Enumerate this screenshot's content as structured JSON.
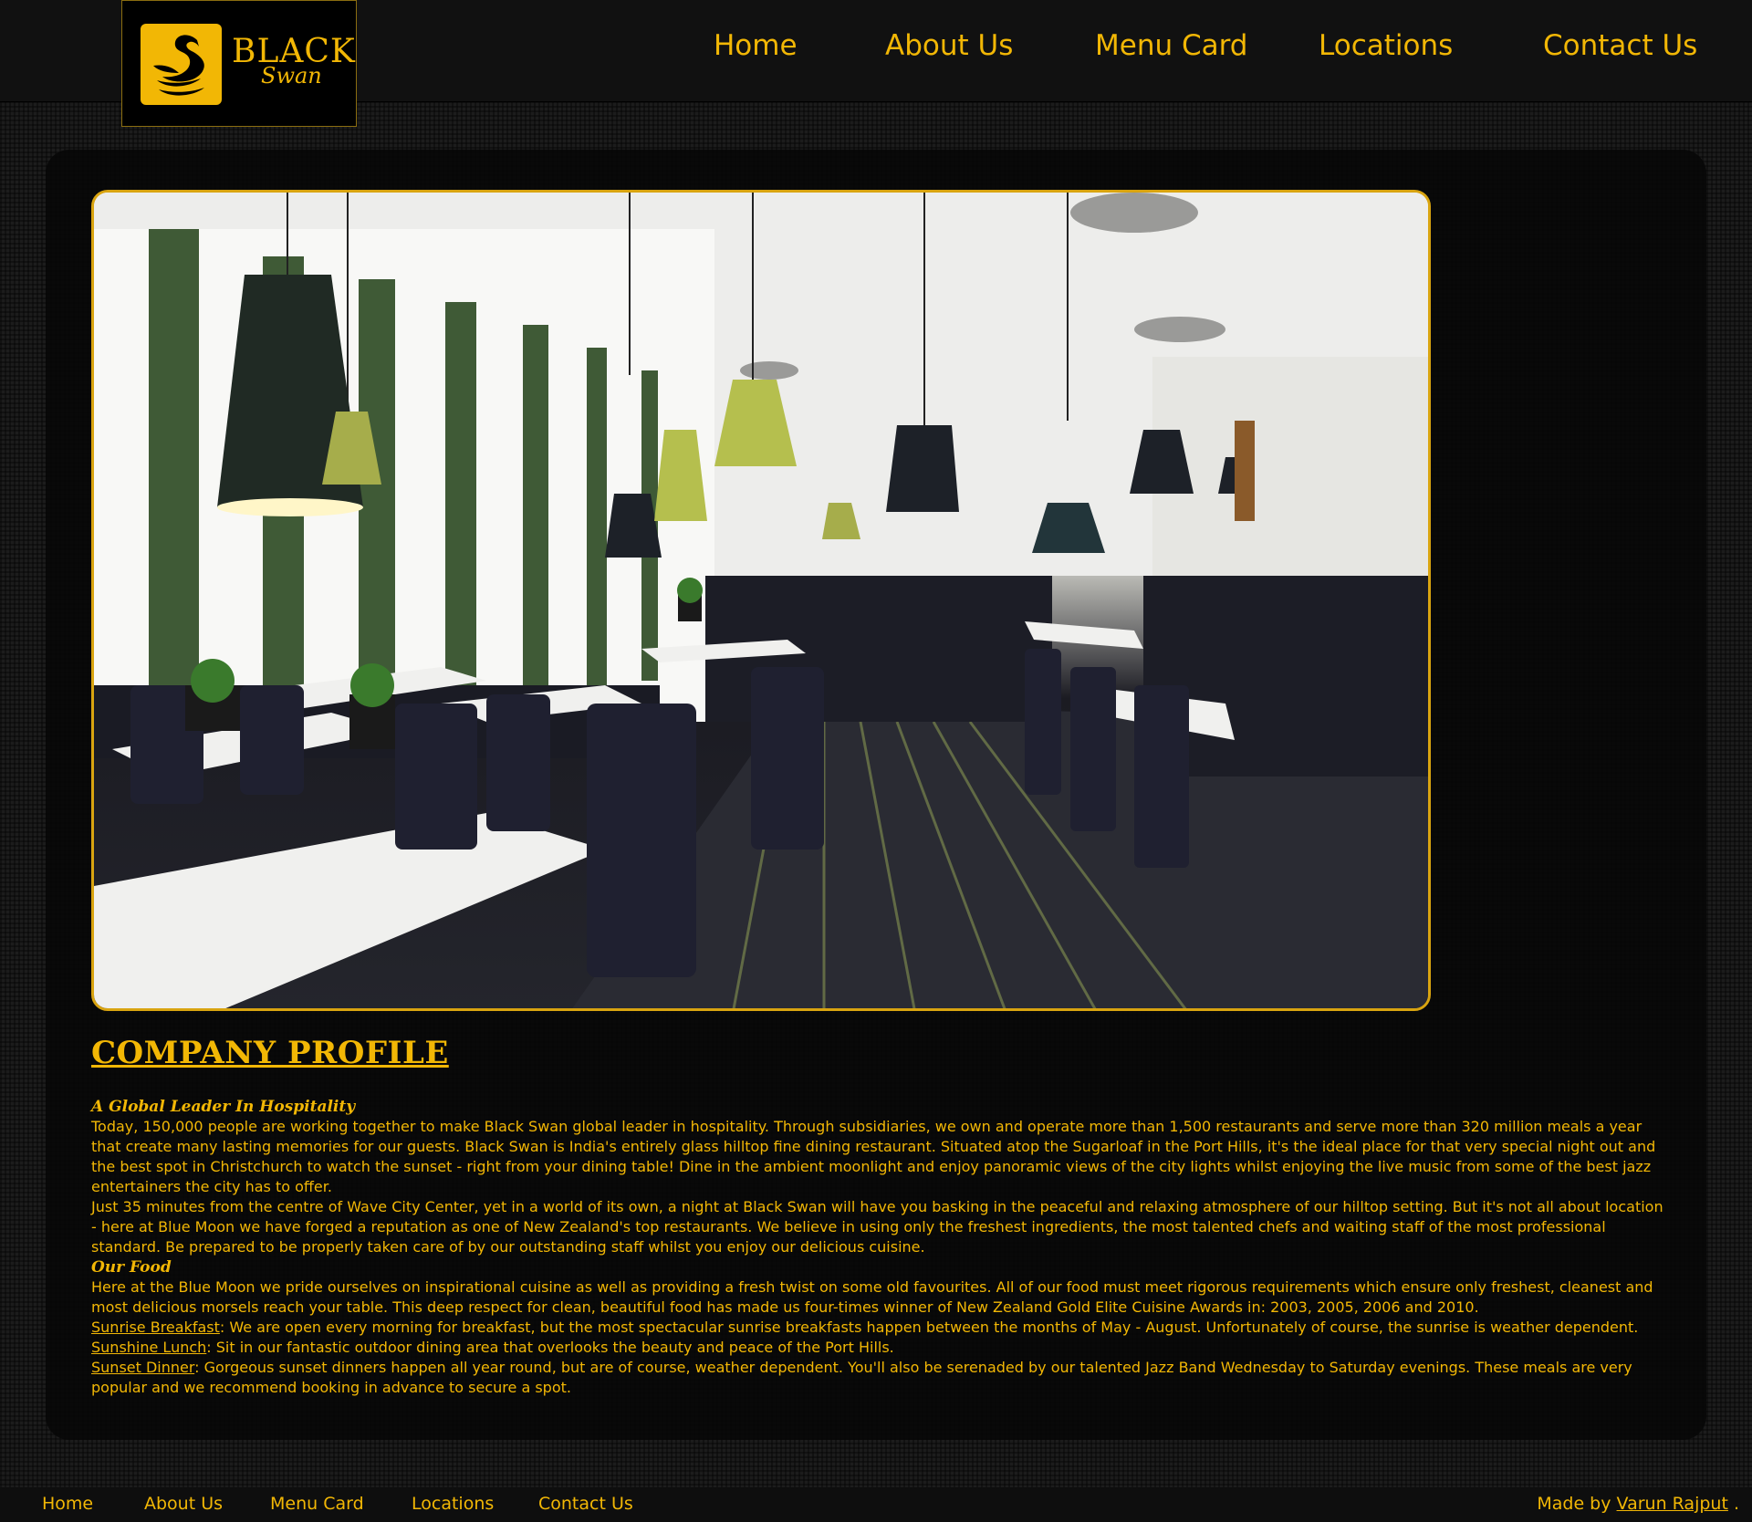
{
  "brand": {
    "logo_word": "BLACK",
    "logo_script": "Swan",
    "accent_color": "#f2b705",
    "background_color": "#141414"
  },
  "nav": {
    "items": [
      "Home",
      "About Us",
      "Menu Card",
      "Locations",
      "Contact Us"
    ]
  },
  "hero": {
    "icon": "restaurant-dining-room-photo"
  },
  "profile": {
    "title": "COMPANY PROFILE",
    "heading_1": "A Global Leader In Hospitality",
    "para_1": "Today, 150,000 people are working together to make Black Swan global leader in hospitality. Through subsidiaries, we own and operate more than 1,500 restaurants and serve more than 320 million meals a year that create many lasting memories for our guests. Black Swan is India's entirely glass hilltop fine dining restaurant. Situated atop the Sugarloaf in the Port Hills, it's the ideal place for that very special night out and the best spot in Christchurch to watch the sunset - right from your dining table! Dine in the ambient moonlight and enjoy panoramic views of the city lights whilst enjoying the live music from some of the best jazz entertainers the city has to offer.",
    "para_2": "Just 35 minutes from the centre of Wave City Center, yet in a world of its own, a night at Black Swan will have you basking in the peaceful and relaxing atmosphere of our hilltop setting. But it's not all about location - here at Blue Moon we have forged a reputation as one of New Zealand's top restaurants. We believe in using only the freshest ingredients, the most talented chefs and waiting staff of the most professional standard. Be prepared to be properly taken care of by our outstanding staff whilst you enjoy our delicious cuisine.",
    "heading_2": "Our Food",
    "para_3": "Here at the Blue Moon we pride ourselves on inspirational cuisine as well as providing a fresh twist on some old favourites. All of our food must meet rigorous requirements which ensure only freshest, cleanest and most delicious morsels reach your table. This deep respect for clean, beautiful food has made us four-times winner of New Zealand Gold Elite Cuisine Awards in: 2003, 2005, 2006 and 2010.",
    "meals": [
      {
        "label": "Sunrise Breakfast",
        "text": ": We are open every morning for breakfast, but the most spectacular sunrise breakfasts happen between the months of May - August. Unfortunately of course, the sunrise is weather dependent."
      },
      {
        "label": "Sunshine Lunch",
        "text": ": Sit in our fantastic outdoor dining area that overlooks the beauty and peace of the Port Hills."
      },
      {
        "label": "Sunset Dinner",
        "text": ": Gorgeous sunset dinners happen all year round, but are of course, weather dependent. You'll also be serenaded by our talented Jazz Band Wednesday to Saturday evenings. These meals are very popular and we recommend booking in advance to secure a spot."
      }
    ]
  },
  "footer": {
    "items": [
      "Home",
      "About Us",
      "Menu Card",
      "Locations",
      "Contact Us"
    ],
    "credit_prefix": "Made by",
    "credit_author": "Varun Rajput",
    "credit_suffix": " ."
  }
}
